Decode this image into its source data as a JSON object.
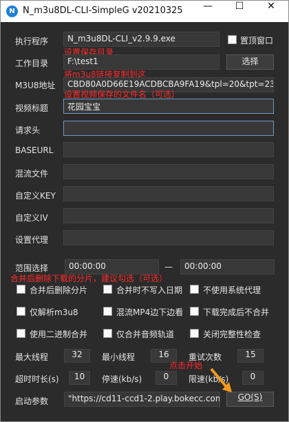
{
  "window": {
    "title": "N_m3u8DL-CLI-SimpleG v20210325",
    "icon_letter": "N",
    "minimize": "—",
    "maximize": "☐",
    "close": "✕"
  },
  "fields": {
    "exe_label": "执行程序",
    "exe_value": "N_m3u8DL-CLI_v2.9.9.exe",
    "topmost_label": "置顶窗口",
    "workdir_label": "工作目录",
    "workdir_value": "F:\\test1",
    "choose_button": "选择",
    "m3u8_label": "M3U8地址",
    "m3u8_value": "CBD80A0D66E19ACDBCBA9FA19&tpl=20&tpt=230",
    "title_label": "视频标题",
    "title_value": "花园宝宝",
    "headers_label": "请求头",
    "baseurl_label": "BASEURL",
    "mixfile_label": "混流文件",
    "key_label": "自定义KEY",
    "iv_label": "自定义IV",
    "proxy_label": "设置代理",
    "range_label": "范围选择",
    "range_start": "00:00:00",
    "range_dash": "—",
    "range_end": "00:00:00"
  },
  "annotations": {
    "set_dir": "设置保存目录",
    "paste_link": "将m3u8链接复制到这",
    "set_name": "设置视频保存的文件名（可选）",
    "merge_delete": "合并后删除下载的分片，建议勾选（可选）",
    "click_start": "点击开始"
  },
  "checkboxes": [
    {
      "label": "合并后删除分片"
    },
    {
      "label": "合并时不写入日期"
    },
    {
      "label": "不使用系统代理"
    },
    {
      "label": "仅解析m3u8"
    },
    {
      "label": "混流MP4边下边看"
    },
    {
      "label": "下载完成后不合并"
    },
    {
      "label": "使用二进制合并"
    },
    {
      "label": "仅合并音频轨道"
    },
    {
      "label": "关闭完整性检查"
    }
  ],
  "numbers": {
    "max_threads_label": "最大线程",
    "max_threads": "32",
    "min_threads_label": "最小线程",
    "min_threads": "16",
    "retry_label": "重试次数",
    "retry": "15",
    "timeout_label": "超时时长(s)",
    "timeout": "10",
    "stop_speed_label": "停速(kb/s)",
    "stop_speed": "0",
    "limit_speed_label": "限速(kb/s)",
    "limit_speed": "0"
  },
  "launch": {
    "label": "启动参数",
    "value": "\"https://cd11-ccd1-2.play.bokecc.com",
    "go_button": "GO(S)"
  }
}
